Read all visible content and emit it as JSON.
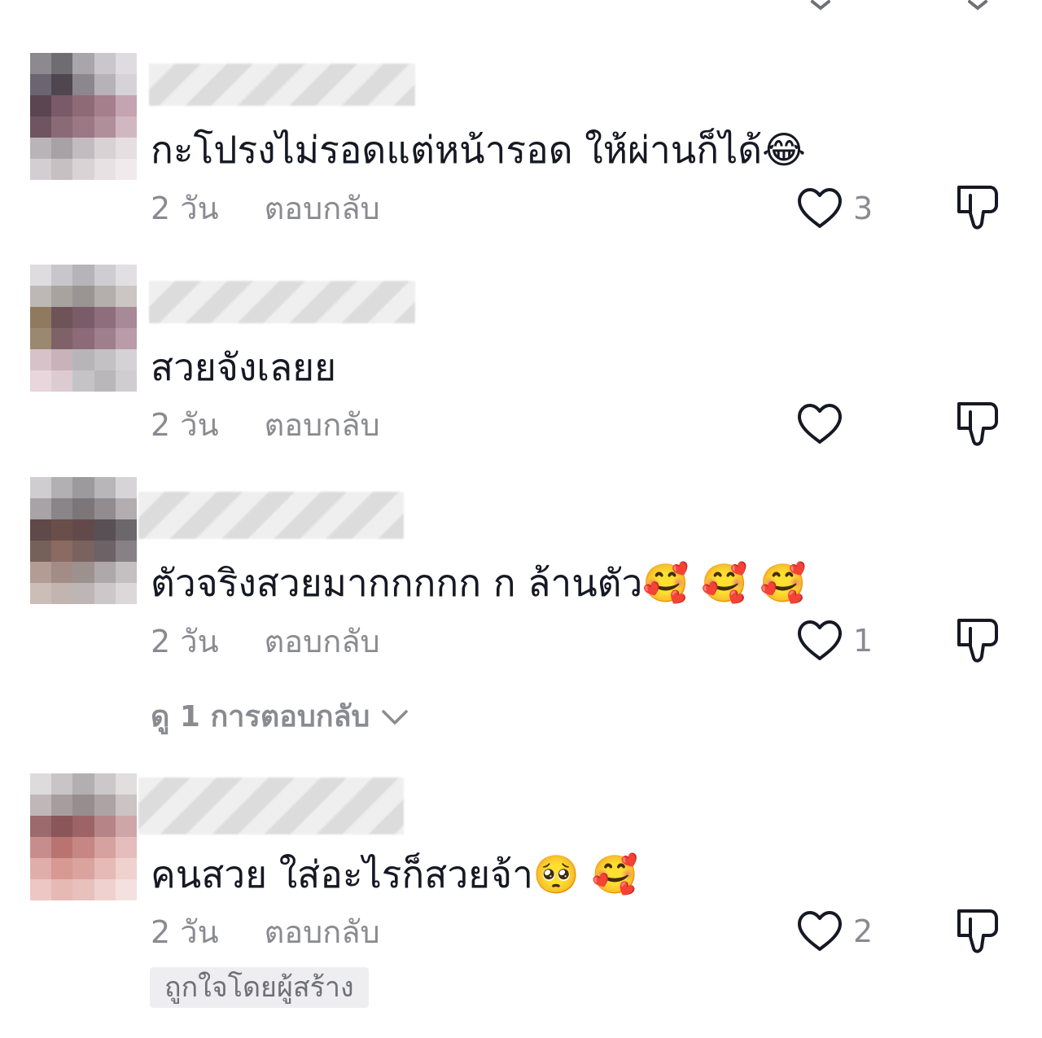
{
  "comments": [
    {
      "text": "กะโปรงไม่รอดแต่หน้ารอด ให้ผ่านก็ได้😂",
      "time": "2 วัน",
      "reply_label": "ตอบกลับ",
      "like_count": "3"
    },
    {
      "text": "สวยจังเลยย",
      "time": "2 วัน",
      "reply_label": "ตอบกลับ",
      "like_count": ""
    },
    {
      "text": "ตัวจริงสวยมากกกกก ก ล้านตัว🥰 🥰 🥰",
      "time": "2 วัน",
      "reply_label": "ตอบกลับ",
      "like_count": "1",
      "view_replies": "ดู 1 การตอบกลับ"
    },
    {
      "text": "คนสวย ใส่อะไรก็สวยจ้า🥺 🥰",
      "time": "2 วัน",
      "reply_label": "ตอบกลับ",
      "like_count": "2",
      "badge": "ถูกใจโดยผู้สร้าง"
    }
  ],
  "icons": {
    "like": "heart-outline-icon",
    "dislike": "thumbs-down-outline-icon",
    "expand": "chevron-down-icon"
  },
  "colors": {
    "text_primary": "#161823",
    "text_secondary": "#8a8b91",
    "icon_stroke": "#161823",
    "badge_bg": "#eeeef0"
  }
}
